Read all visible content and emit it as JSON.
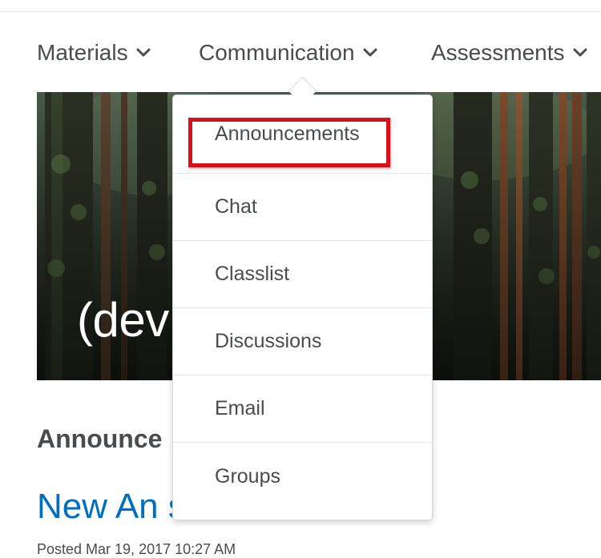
{
  "nav": {
    "items": [
      {
        "label": "Materials",
        "icon": "chevron-down-icon"
      },
      {
        "label": "Communication",
        "icon": "chevron-down-icon"
      },
      {
        "label": "Assessments",
        "icon": "chevron-down-icon"
      }
    ]
  },
  "banner": {
    "title": "(dev                     's Sandb"
  },
  "announcements": {
    "heading": "Announce",
    "item_title": "New An                     st of SMS",
    "posted": "Posted Mar 19, 2017 10:27 AM"
  },
  "communication_menu": {
    "items": [
      {
        "label": "Announcements"
      },
      {
        "label": "Chat"
      },
      {
        "label": "Classlist"
      },
      {
        "label": "Discussions"
      },
      {
        "label": "Email"
      },
      {
        "label": "Groups"
      }
    ]
  },
  "colors": {
    "nav_text": "#494c4e",
    "link": "#006fbf",
    "highlight": "#d7101a",
    "menu_border": "#d3d9e3"
  }
}
